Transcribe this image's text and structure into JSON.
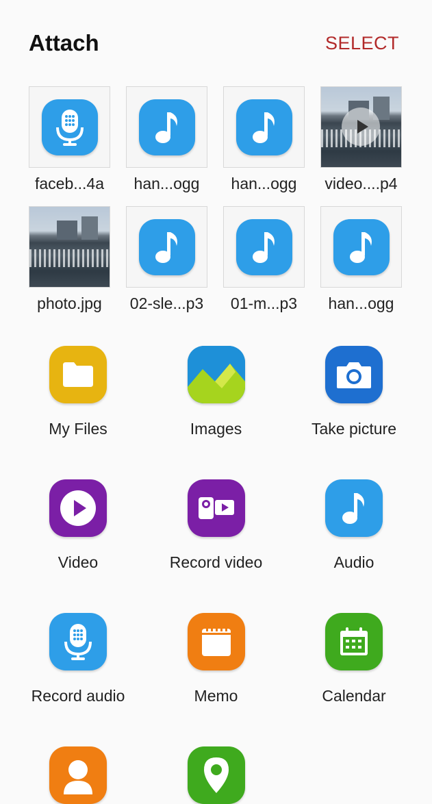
{
  "header": {
    "title": "Attach",
    "select_label": "SELECT"
  },
  "recent": {
    "row1": [
      {
        "label": "faceb...4a",
        "type": "voice",
        "icon": "microphone-icon"
      },
      {
        "label": "han...ogg",
        "type": "audio",
        "icon": "music-note-icon"
      },
      {
        "label": "han...ogg",
        "type": "audio",
        "icon": "music-note-icon"
      },
      {
        "label": "video....p4",
        "type": "video",
        "icon": "play-icon"
      }
    ],
    "row2": [
      {
        "label": "photo.jpg",
        "type": "photo",
        "icon": "photo-thumbnail"
      },
      {
        "label": "02-sle...p3",
        "type": "audio",
        "icon": "music-note-icon"
      },
      {
        "label": "01-m...p3",
        "type": "audio",
        "icon": "music-note-icon"
      },
      {
        "label": "han...ogg",
        "type": "audio",
        "icon": "music-note-icon"
      }
    ]
  },
  "apps": {
    "my_files": "My Files",
    "images": "Images",
    "take_picture": "Take picture",
    "video": "Video",
    "record_video": "Record video",
    "audio": "Audio",
    "record_audio": "Record audio",
    "memo": "Memo",
    "calendar": "Calendar"
  },
  "colors": {
    "accent": "#b22a2a",
    "audio_blue": "#2e9ee8",
    "files_yellow": "#e7b411",
    "camera_blue": "#1e6fd0",
    "video_purple": "#7b1fa6",
    "memo_orange": "#f07e12",
    "calendar_green": "#3faa1e"
  }
}
